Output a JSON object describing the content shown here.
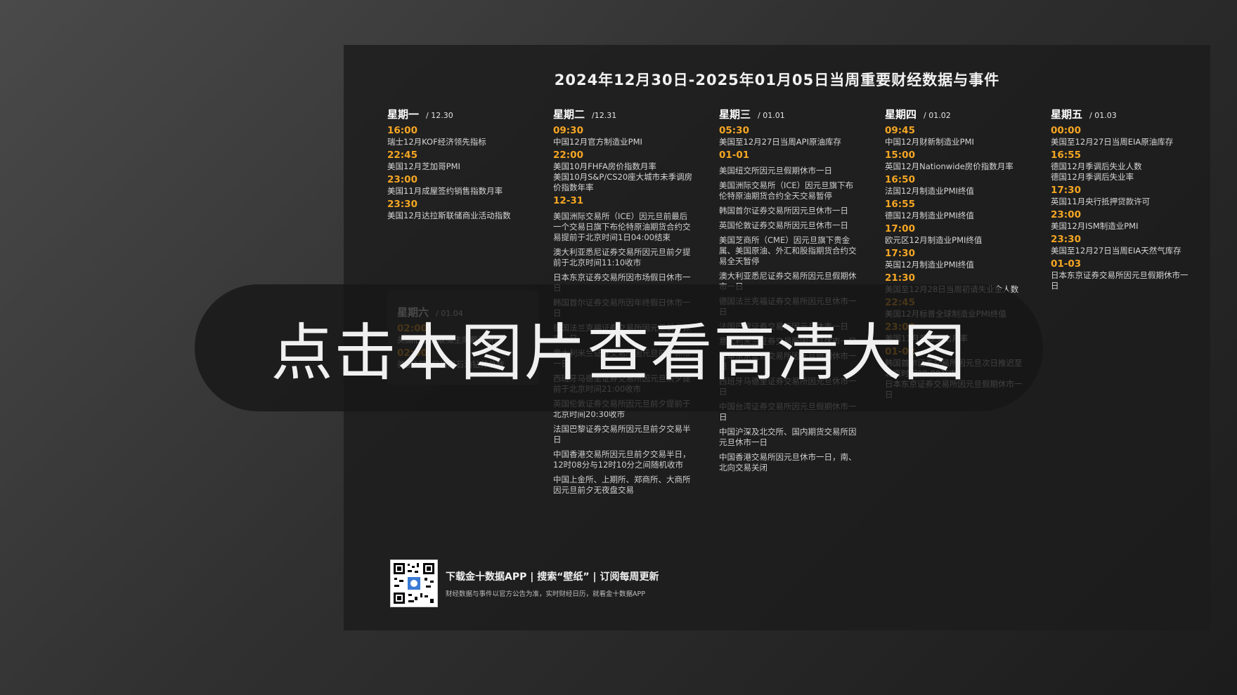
{
  "title": "2024年12月30日-2025年01月05日当周重要财经数据与事件",
  "days": [
    {
      "day": "星期一",
      "date": "/ 12.30",
      "events": [
        {
          "time": "16:00",
          "desc": "瑞士12月KOF经济领先指标"
        },
        {
          "time": "22:45",
          "desc": "美国12月芝加哥PMI"
        },
        {
          "time": "23:00",
          "desc": "美国11月成屋签约销售指数月率"
        },
        {
          "time": "23:30",
          "desc": "美国12月达拉斯联储商业活动指数"
        }
      ]
    },
    {
      "day": "星期二",
      "date": "/12.31",
      "events": [
        {
          "time": "09:30",
          "desc": "中国12月官方制造业PMI"
        },
        {
          "time": "22:00",
          "desc": "美国10月FHFA房价指数月率\n美国10月S&P/CS20座大城市未季调房价指数年率"
        },
        {
          "time": "12-31",
          "desc": ""
        }
      ],
      "notices": [
        "美国洲际交易所（ICE）因元旦前最后一个交易日旗下布伦特原油期货合约交易提前于北京时间1日04:00结束",
        "澳大利亚悉尼证券交易所因元旦前夕提前于北京时间11:10收市",
        "日本东京证券交易所因市场假日休市一日",
        "韩国首尔证券交易所因年终假日休市一日",
        "德国法兰克福证券交易所因元旦前夕休市一日",
        "意大利米兰证券交易所因元旦前夕休市一日",
        "西班牙马德里证券交易所因元旦前夕提前于北京时间21:00收市",
        "英国伦敦证券交易所因元旦前夕提前于北京时间20:30收市",
        "法国巴黎证券交易所因元旦前夕交易半日",
        "中国香港交易所因元旦前夕交易半日，12时08分与12时10分之间随机收市",
        "中国上金所、上期所、郑商所、大商所因元旦前夕无夜盘交易"
      ]
    },
    {
      "day": "星期三",
      "date": "/ 01.01",
      "events": [
        {
          "time": "05:30",
          "desc": "美国至12月27日当周API原油库存"
        },
        {
          "time": "01-01",
          "desc": ""
        }
      ],
      "notices": [
        "美国纽交所因元旦假期休市一日",
        "美国洲际交易所（ICE）因元旦旗下布伦特原油期货合约全天交易暂停",
        "韩国首尔证券交易所因元旦休市一日",
        "英国伦敦证券交易所因元旦休市一日",
        "美国芝商所（CME）因元旦旗下贵金属、美国原油、外汇和股指期货合约交易全天暂停",
        "澳大利亚悉尼证券交易所因元旦假期休市一日",
        "德国法兰克福证券交易所因元旦休市一日",
        "法国巴黎证券交易所因元旦休市一日",
        "意大利米兰证券交易所因元旦休市一日",
        "日本东京证券交易所因元旦假期休市一日",
        "西班牙马德里证券交易所因元旦休市一日",
        "中国台湾证券交易所因元旦假期休市一日",
        "中国沪深及北交所、国内期货交易所因元旦休市一日",
        "中国香港交易所因元旦休市一日，南、北向交易关闭"
      ]
    },
    {
      "day": "星期四",
      "date": "/ 01.02",
      "events": [
        {
          "time": "09:45",
          "desc": "中国12月财新制造业PMI"
        },
        {
          "time": "15:00",
          "desc": "英国12月Nationwide房价指数月率"
        },
        {
          "time": "16:50",
          "desc": "法国12月制造业PMI终值"
        },
        {
          "time": "16:55",
          "desc": "德国12月制造业PMI终值"
        },
        {
          "time": "17:00",
          "desc": "欧元区12月制造业PMI终值"
        },
        {
          "time": "17:30",
          "desc": "英国12月制造业PMI终值"
        },
        {
          "time": "21:30",
          "desc": "美国至12月28日当周初请失业金人数"
        },
        {
          "time": "22:45",
          "desc": "美国12月标普全球制造业PMI终值"
        },
        {
          "time": "23:00",
          "desc": "美国11月营建支出月率"
        },
        {
          "time": "01-02",
          "desc": "韩国首尔证券交易所因元旦次日推迟至北京时间09:00开市\n日本东京证券交易所因元旦假期休市一日"
        }
      ]
    },
    {
      "day": "星期五",
      "date": "/ 01.03",
      "events": [
        {
          "time": "00:00",
          "desc": "美国至12月27日当周EIA原油库存"
        },
        {
          "time": "16:55",
          "desc": "德国12月季调后失业人数\n德国12月季调后失业率"
        },
        {
          "time": "17:30",
          "desc": "英国11月央行抵押贷款许可"
        },
        {
          "time": "23:00",
          "desc": "美国12月ISM制造业PMI"
        },
        {
          "time": "23:30",
          "desc": "美国至12月27日当周EIA天然气库存"
        },
        {
          "time": "01-03",
          "desc": "日本东京证券交易所因元旦假期休市一日"
        }
      ]
    }
  ],
  "saturday": {
    "day": "星期六",
    "date": "/ 01.04",
    "events": [
      {
        "time": "02:00",
        "desc": "美国旧金山联储主席戴利讲话"
      },
      {
        "time": "02:00",
        "desc": "美国1月3日当周石油钻井总数"
      }
    ]
  },
  "overlay_text": "点击本图片查看高清大图",
  "footer": {
    "line1": "下载金十数据APP | 搜索“壁纸” | 订阅每周更新",
    "line2": "财经数据与事件以官方公告为准，实时财经日历，就看金十数据APP"
  },
  "colors": {
    "time": "#f5a623",
    "panel": "#1c1c1c",
    "overlay": "#161616"
  },
  "icons": {
    "qr": "qr-code-icon"
  }
}
